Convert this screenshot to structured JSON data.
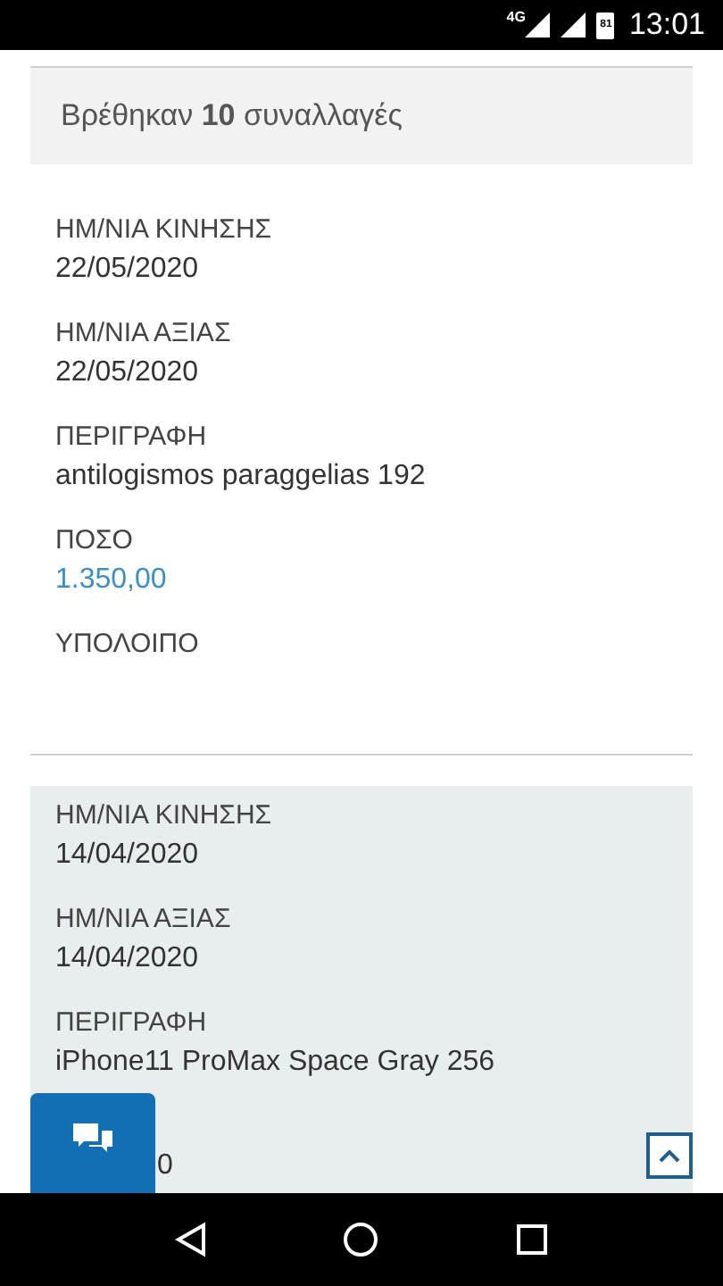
{
  "status_bar": {
    "network": "4G",
    "battery": "81",
    "time": "13:01"
  },
  "results_summary": "Βρέθηκαν **10** συναλλαγές",
  "transactions": [
    {
      "shaded": false,
      "fields": [
        {
          "label": "ΗΜ/ΝΙΑ ΚΙΝΗΣΗΣ",
          "value": "22/05/2020",
          "kind": "text"
        },
        {
          "label": "ΗΜ/ΝΙΑ ΑΞΙΑΣ",
          "value": "22/05/2020",
          "kind": "text"
        },
        {
          "label": "ΠΕΡΙΓΡΑΦΗ",
          "value": "antilogismos paraggelias 192",
          "kind": "text"
        },
        {
          "label": "ΠΟΣΟ",
          "value": "1.350,00",
          "kind": "amount"
        },
        {
          "label": "ΥΠΟΛΟΙΠΟ"
        }
      ]
    },
    {
      "shaded": true,
      "fields": [
        {
          "label": "ΗΜ/ΝΙΑ ΚΙΝΗΣΗΣ",
          "value": "14/04/2020",
          "kind": "text"
        },
        {
          "label": "ΗΜ/ΝΙΑ ΑΞΙΑΣ",
          "value": "14/04/2020",
          "kind": "text"
        },
        {
          "label": "ΠΕΡΙΓΡΑΦΗ",
          "value": "iPhone11 ProMax Space Gray 256",
          "kind": "text"
        },
        {
          "value": "0",
          "kind": "covered"
        }
      ]
    }
  ]
}
